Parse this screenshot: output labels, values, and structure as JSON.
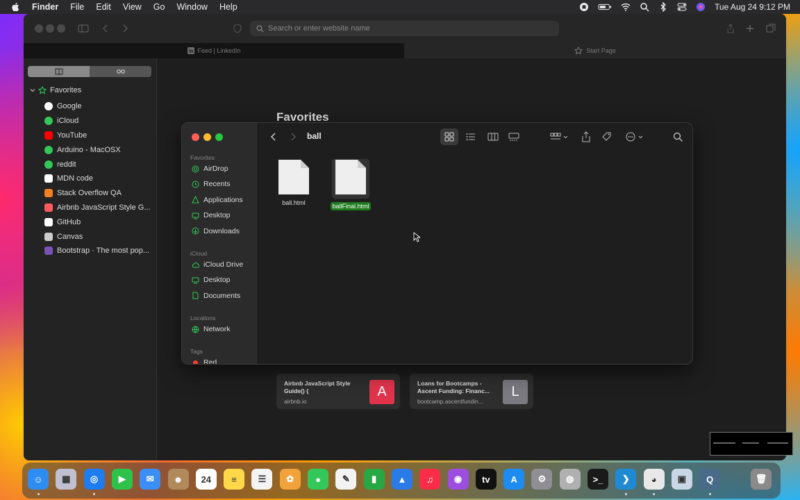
{
  "menubar": {
    "app": "Finder",
    "items": [
      "File",
      "Edit",
      "View",
      "Go",
      "Window",
      "Help"
    ],
    "clock": "Tue Aug 24  9:12 PM"
  },
  "safari": {
    "address_placeholder": "Search or enter website name",
    "tabs": [
      {
        "label": "Feed | LinkedIn",
        "icon": "linkedin-icon"
      },
      {
        "label": "Start Page",
        "icon": "star-icon"
      }
    ],
    "sidebar": {
      "section": "Favorites",
      "bookmarks": [
        {
          "label": "Google",
          "icon": "google-icon",
          "color": "#ffffff"
        },
        {
          "label": "iCloud",
          "icon": "globe-icon",
          "color": "#34c759"
        },
        {
          "label": "YouTube",
          "icon": "youtube-icon",
          "color": "#ff0000"
        },
        {
          "label": "Arduino - MacOSX",
          "icon": "compass-icon",
          "color": "#34c759"
        },
        {
          "label": "reddit",
          "icon": "globe-icon",
          "color": "#34c759"
        },
        {
          "label": "MDN code",
          "icon": "mdn-icon",
          "color": "#ffffff"
        },
        {
          "label": "Stack Overflow QA",
          "icon": "stackoverflow-icon",
          "color": "#f48024"
        },
        {
          "label": "Airbnb JavaScript Style G...",
          "icon": "airbnb-icon",
          "color": "#ff5a5f"
        },
        {
          "label": "GitHub",
          "icon": "github-icon",
          "color": "#ffffff"
        },
        {
          "label": "Canvas",
          "icon": "canvas-icon",
          "color": "#cccccc"
        },
        {
          "label": "Bootstrap · The most pop...",
          "icon": "bootstrap-icon",
          "color": "#7952b3"
        }
      ]
    },
    "content": {
      "title": "Favorites",
      "cards": [
        {
          "title": "Airbnb JavaScript Style Guide() {",
          "url": "airbnb.io",
          "letter": "A",
          "color": "#e0344c"
        },
        {
          "title": "Loans for Bootcamps - Ascent Funding: Financ...",
          "url": "bootcamp.ascentfundin...",
          "letter": "L",
          "color": "#7a7a80"
        }
      ]
    }
  },
  "finder": {
    "title": "ball",
    "sections": [
      {
        "heading": "Favorites",
        "items": [
          {
            "label": "AirDrop",
            "icon": "airdrop-icon"
          },
          {
            "label": "Recents",
            "icon": "clock-icon"
          },
          {
            "label": "Applications",
            "icon": "applications-icon"
          },
          {
            "label": "Desktop",
            "icon": "desktop-icon"
          },
          {
            "label": "Downloads",
            "icon": "downloads-icon"
          }
        ]
      },
      {
        "heading": "iCloud",
        "items": [
          {
            "label": "iCloud Drive",
            "icon": "cloud-icon"
          },
          {
            "label": "Desktop",
            "icon": "desktop-icon"
          },
          {
            "label": "Documents",
            "icon": "document-icon"
          }
        ]
      },
      {
        "heading": "Locations",
        "items": [
          {
            "label": "Network",
            "icon": "network-icon"
          }
        ]
      },
      {
        "heading": "Tags",
        "items": [
          {
            "label": "Red",
            "icon": "red-tag-icon"
          }
        ]
      }
    ],
    "files": [
      {
        "name": "ball.html",
        "selected": false
      },
      {
        "name": "ballFinal.html",
        "selected": true
      }
    ]
  },
  "dock": {
    "apps": [
      {
        "name": "Finder",
        "color": "#2f8cf0",
        "glyph": "☺",
        "running": true
      },
      {
        "name": "Launchpad",
        "color": "#c0c0d0",
        "glyph": "▦",
        "running": false
      },
      {
        "name": "Safari",
        "color": "#1e7bf0",
        "glyph": "◎",
        "running": true
      },
      {
        "name": "FaceTime",
        "color": "#2fc24a",
        "glyph": "▶",
        "running": false
      },
      {
        "name": "Mail",
        "color": "#3a8ef6",
        "glyph": "✉",
        "running": false
      },
      {
        "name": "Contacts",
        "color": "#b08a5a",
        "glyph": "☻",
        "running": false
      },
      {
        "name": "Calendar",
        "color": "#ffffff",
        "glyph": "24",
        "running": false
      },
      {
        "name": "Notes",
        "color": "#ffd84a",
        "glyph": "≡",
        "running": false
      },
      {
        "name": "Reminders",
        "color": "#f4f4f4",
        "glyph": "☰",
        "running": false
      },
      {
        "name": "Photos",
        "color": "#f2a23a",
        "glyph": "✿",
        "running": false
      },
      {
        "name": "Messages",
        "color": "#34c759",
        "glyph": "●",
        "running": false
      },
      {
        "name": "Freeform",
        "color": "#f3f3f3",
        "glyph": "✎",
        "running": false
      },
      {
        "name": "Numbers",
        "color": "#27a844",
        "glyph": "▮",
        "running": false
      },
      {
        "name": "Keynote",
        "color": "#2a7ae8",
        "glyph": "▲",
        "running": false
      },
      {
        "name": "Music",
        "color": "#fa2d48",
        "glyph": "♫",
        "running": false
      },
      {
        "name": "Podcasts",
        "color": "#9b4ee0",
        "glyph": "◉",
        "running": false
      },
      {
        "name": "TV",
        "color": "#111111",
        "glyph": "tv",
        "running": false
      },
      {
        "name": "App Store",
        "color": "#1c8cf2",
        "glyph": "A",
        "running": false
      },
      {
        "name": "System Preferences",
        "color": "#8e8e93",
        "glyph": "⚙",
        "running": false
      },
      {
        "name": "Disk Utility",
        "color": "#b0b0b0",
        "glyph": "◍",
        "running": false
      },
      {
        "name": "Terminal",
        "color": "#1a1a1a",
        "glyph": ">_",
        "running": false
      },
      {
        "name": "Visual Studio Code",
        "color": "#1f8ad2",
        "glyph": "❯",
        "running": true
      },
      {
        "name": "Chrome",
        "color": "#e8e8e8",
        "glyph": "◕",
        "running": true
      },
      {
        "name": "Preview",
        "color": "#c9d6e6",
        "glyph": "▣",
        "running": false
      },
      {
        "name": "QuickTime",
        "color": "#4a6a8a",
        "glyph": "Q",
        "running": true
      },
      {
        "name": "Trash",
        "color": "#8a8a8a",
        "glyph": "🗑",
        "running": false
      }
    ]
  }
}
